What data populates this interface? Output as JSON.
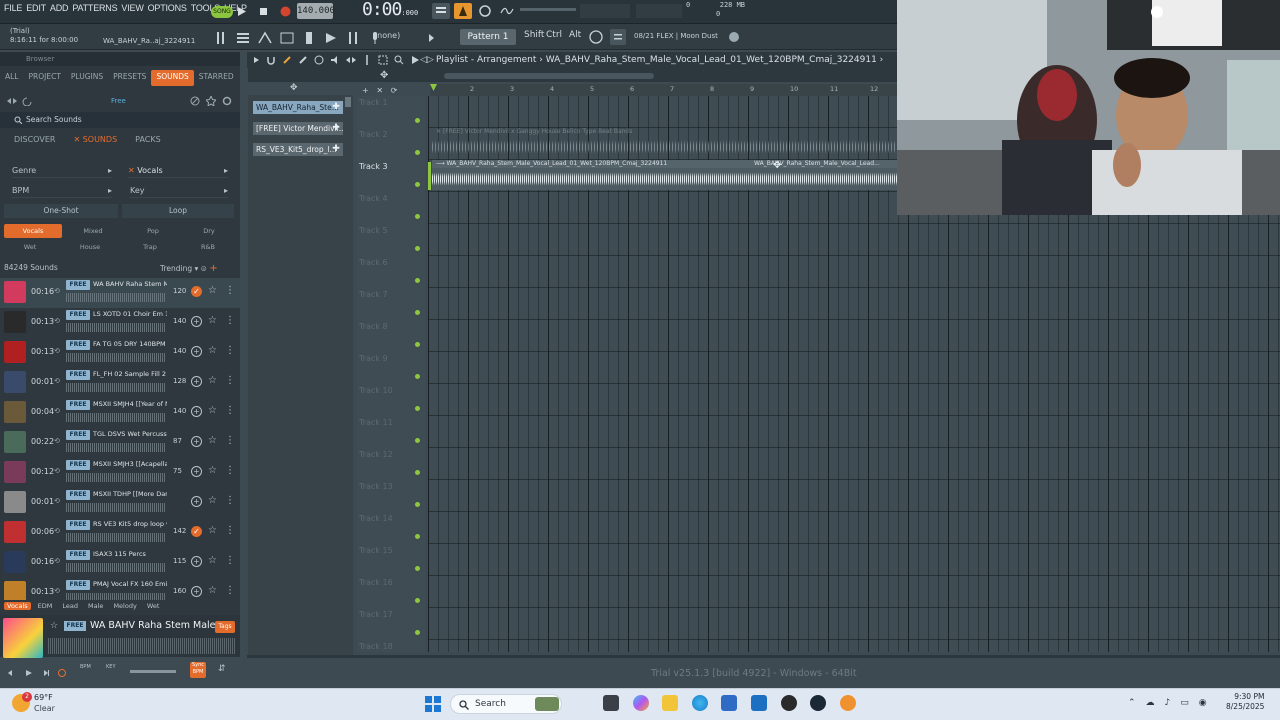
{
  "menu": [
    "FILE",
    "EDIT",
    "ADD",
    "PATTERNS",
    "VIEW",
    "OPTIONS",
    "TOOLS",
    "HELP"
  ],
  "toolbar": {
    "song_label": "SONG",
    "tempo": "140.000",
    "time_main": "0:00",
    "time_sub": ":000",
    "mem_top": "228 MB",
    "mem_bottom": "0",
    "mem_left": "0",
    "trial_label": "(Trial)",
    "trial_time": "8:16:11 for 8:00:00",
    "hint": "WA_BAHV_Ra..aj_3224911",
    "none": "(none)",
    "pattern": "Pattern 1",
    "keys": [
      "Shift",
      "Ctrl",
      "Alt"
    ],
    "flex": "08/21  FLEX | Moon Dust"
  },
  "browser": {
    "title": "Browser",
    "tabs": [
      "ALL",
      "PROJECT",
      "PLUGINS",
      "PRESETS",
      "SOUNDS",
      "STARRED"
    ],
    "active_tab": "SOUNDS",
    "free_chip": "Free",
    "search_placeholder": "Search Sounds",
    "subtabs": [
      "DISCOVER",
      "SOUNDS",
      "PACKS"
    ],
    "filters": {
      "genre": "Genre",
      "vocals": "Vocals",
      "bpm": "BPM",
      "key": "Key",
      "oneshot": "One-Shot",
      "loop": "Loop"
    },
    "tags_row1": [
      "Vocals",
      "Mixed",
      "Pop",
      "Dry"
    ],
    "tags_row2": [
      "Wet",
      "House",
      "Trap",
      "R&B"
    ],
    "count": "84249 Sounds",
    "sort": "Trending",
    "sounds": [
      {
        "dur": "00:16",
        "free": "FREE",
        "name": "WA BAHV Raha Stem Mal...",
        "bpm": "120",
        "added": true,
        "color": "#d23b5d"
      },
      {
        "dur": "00:13",
        "free": "FREE",
        "name": "LS XOTD 01 Choir Em 140",
        "bpm": "140",
        "added": false,
        "color": "#2a2a2a"
      },
      {
        "dur": "00:13",
        "free": "FREE",
        "name": "FA TG 05 DRY 140BPM D...",
        "bpm": "140",
        "added": false,
        "color": "#b02020"
      },
      {
        "dur": "00:01",
        "free": "FREE",
        "name": "FL_FH 02 Sample Fill 2 1...",
        "bpm": "128",
        "added": false,
        "color": "#3a4a6a"
      },
      {
        "dur": "00:04",
        "free": "FREE",
        "name": "MSXII SMJH4 [[Year of N...",
        "bpm": "140",
        "added": false,
        "color": "#6a5a3a"
      },
      {
        "dur": "00:22",
        "free": "FREE",
        "name": "TGL DSVS Wet Percussio...",
        "bpm": "87",
        "added": false,
        "color": "#4a6a5a"
      },
      {
        "dur": "00:12",
        "free": "FREE",
        "name": "MSXII SMJH3 [[Acapella ...",
        "bpm": "75",
        "added": false,
        "color": "#7a3a5a"
      },
      {
        "dur": "00:01",
        "free": "FREE",
        "name": "MSXII TDHP [[More Dam...",
        "bpm": "",
        "added": false,
        "color": "#8a8a8a"
      },
      {
        "dur": "00:06",
        "free": "FREE",
        "name": "RS VE3 Kit5 drop loop vo...",
        "bpm": "142",
        "added": true,
        "color": "#c03030"
      },
      {
        "dur": "00:16",
        "free": "FREE",
        "name": "ISAX3 115 Percs",
        "bpm": "115",
        "added": false,
        "color": "#2a3a5a"
      },
      {
        "dur": "00:13",
        "free": "FREE",
        "name": "PMAJ Vocal FX 160 Emin ...",
        "bpm": "160",
        "added": false,
        "color": "#c0802a"
      }
    ],
    "pills": [
      "Vocals",
      "EDM",
      "Lead",
      "Male",
      "Melody",
      "Wet"
    ],
    "active_pill": "Vocals",
    "now_playing": {
      "free": "FREE",
      "name": "WA BAHV Raha Stem Male...",
      "tags_label": "Tags"
    },
    "transport": {
      "bpm_label": "BPM",
      "key_label": "KEY",
      "sync_label": "Sync BPM"
    }
  },
  "channels": [
    {
      "name": "WA_BAHV_Raha_Ste...",
      "selected": true
    },
    {
      "name": "[FREE] Victor Mendivil...",
      "selected": false
    },
    {
      "name": "RS_VE3_Kit5_drop_l...",
      "selected": false
    }
  ],
  "playlist": {
    "title": "Playlist - Arrangement",
    "clip_name": "WA_BAHV_Raha_Stem_Male_Vocal_Lead_01_Wet_120BPM_Cmaj_3224911",
    "ruler": [
      "2",
      "3",
      "4",
      "5",
      "6",
      "7",
      "8",
      "9",
      "10",
      "11",
      "12"
    ],
    "tracks": [
      "Track 1",
      "Track 2",
      "Track 3",
      "Track 4",
      "Track 5",
      "Track 6",
      "Track 7",
      "Track 8",
      "Track 9",
      "Track 10",
      "Track 11",
      "Track 12",
      "Track 13",
      "Track 14",
      "Track 15",
      "Track 16",
      "Track 17",
      "Track 18"
    ],
    "active_track": "Track 3",
    "clip1_label": "[FREE] Victor Mendivil x Ganggy House Belico Type Beat Bands",
    "clip2_label": "WA_BAHV_Raha_Stem_Male_Vocal_Lead_01_Wet_120BPM_Cmaj_3224911",
    "clip2b_label": "WA_BAHV_Raha_Stem_Male_Vocal_Lead..."
  },
  "status": {
    "trial": "Trial v25.1.3 [build 4922] - Windows - 64Bit"
  },
  "taskbar": {
    "weather_badge": "2",
    "temp": "69°F",
    "condition": "Clear",
    "search": "Search",
    "time": "9:30 PM",
    "date": "8/25/2025"
  },
  "colors": {
    "accent": "#e36c2c",
    "song_green": "#8cc63f",
    "track_dot": "#8ec63f"
  }
}
